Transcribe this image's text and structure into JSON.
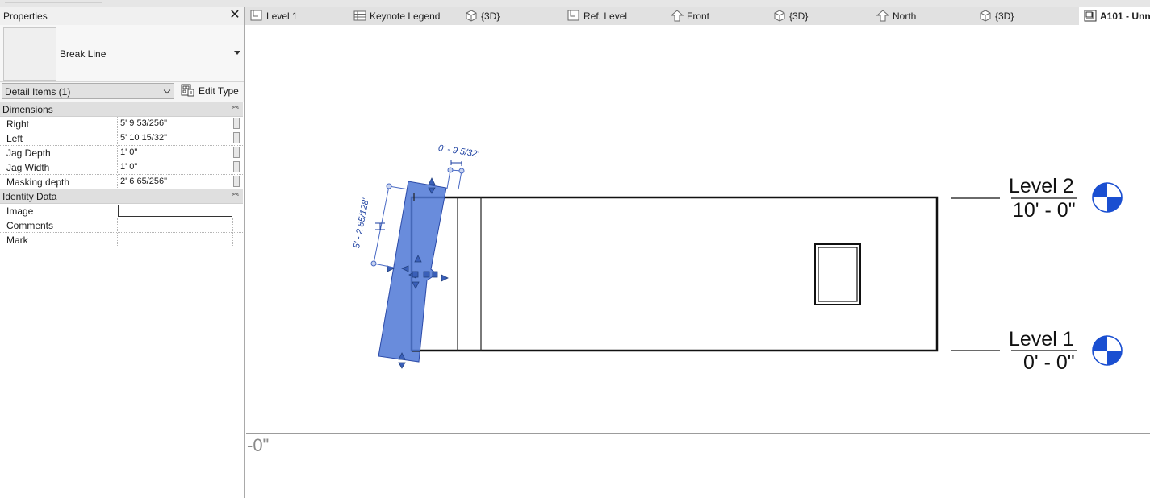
{
  "properties": {
    "title": "Properties",
    "close_glyph": "✕",
    "type_name": "Break Line",
    "filter_label": "Detail Items (1)",
    "edit_type_label": "Edit Type",
    "categories": [
      {
        "name": "Dimensions",
        "rows": [
          {
            "label": "Right",
            "value": "5'  9 53/256\""
          },
          {
            "label": "Left",
            "value": "5'  10 15/32\""
          },
          {
            "label": "Jag Depth",
            "value": "1'  0\""
          },
          {
            "label": "Jag Width",
            "value": "1'  0\""
          },
          {
            "label": "Masking depth",
            "value": "2'  6 65/256\""
          }
        ]
      },
      {
        "name": "Identity Data",
        "rows": [
          {
            "label": "Image",
            "value": ""
          },
          {
            "label": "Comments",
            "value": ""
          },
          {
            "label": "Mark",
            "value": ""
          }
        ]
      }
    ]
  },
  "tabs": [
    {
      "label": "Level 1",
      "icon": "floor-plan-icon"
    },
    {
      "label": "Keynote Legend",
      "icon": "legend-icon"
    },
    {
      "label": "{3D}",
      "icon": "3d-view-icon"
    },
    {
      "label": "Ref. Level",
      "icon": "floor-plan-icon"
    },
    {
      "label": "Front",
      "icon": "elevation-icon"
    },
    {
      "label": "{3D}",
      "icon": "3d-view-icon"
    },
    {
      "label": "North",
      "icon": "elevation-icon"
    },
    {
      "label": "{3D}",
      "icon": "3d-view-icon"
    },
    {
      "label": "A101 - Unn",
      "icon": "sheet-icon",
      "active": true
    }
  ],
  "view": {
    "levels": [
      {
        "name": "Level 2",
        "elevation": "10' - 0\""
      },
      {
        "name": "Level 1",
        "elevation": "0' - 0\""
      }
    ],
    "dimensions": {
      "jag_width": "0' - 9 5/32'",
      "jag_height": "5' - 2 85/128'"
    },
    "clipped_text": "-0\"",
    "colors": {
      "selection_fill": "#4f78d6",
      "level_head_blue": "#1a4fd1",
      "dimension_blue": "#1a3ea0"
    }
  }
}
